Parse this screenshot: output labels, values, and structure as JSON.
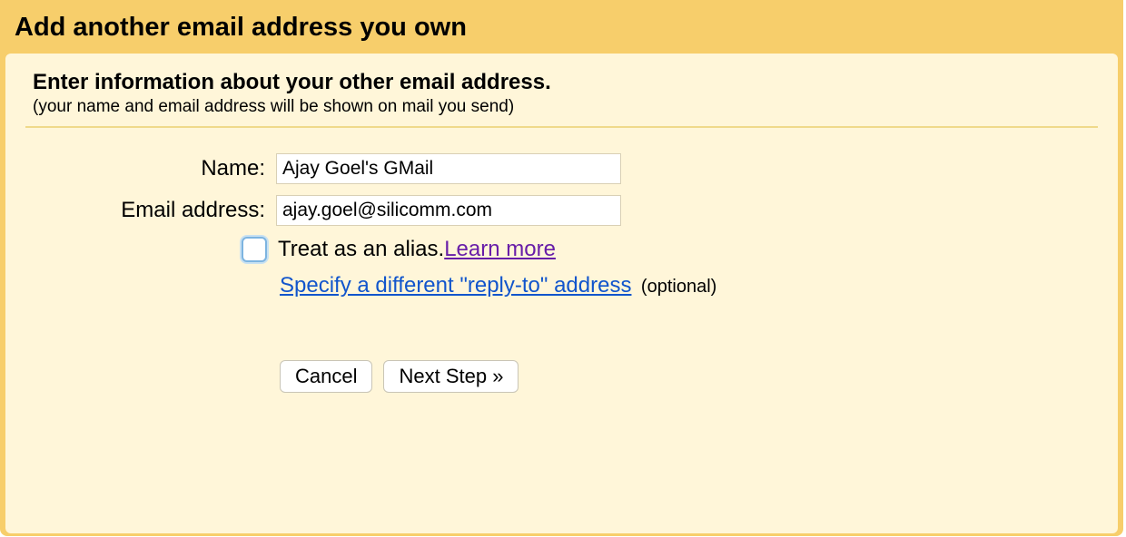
{
  "dialog": {
    "title": "Add another email address you own"
  },
  "section": {
    "heading": "Enter information about your other email address.",
    "sub": "(your name and email address will be shown on mail you send)"
  },
  "form": {
    "name_label": "Name:",
    "name_value": "Ajay Goel's GMail",
    "email_label": "Email address:",
    "email_value": "ajay.goel@silicomm.com"
  },
  "alias": {
    "text": "Treat as an alias. ",
    "learn_more": "Learn more"
  },
  "reply_to": {
    "link": "Specify a different \"reply-to\" address",
    "optional": "(optional)"
  },
  "buttons": {
    "cancel": "Cancel",
    "next": "Next Step »"
  }
}
